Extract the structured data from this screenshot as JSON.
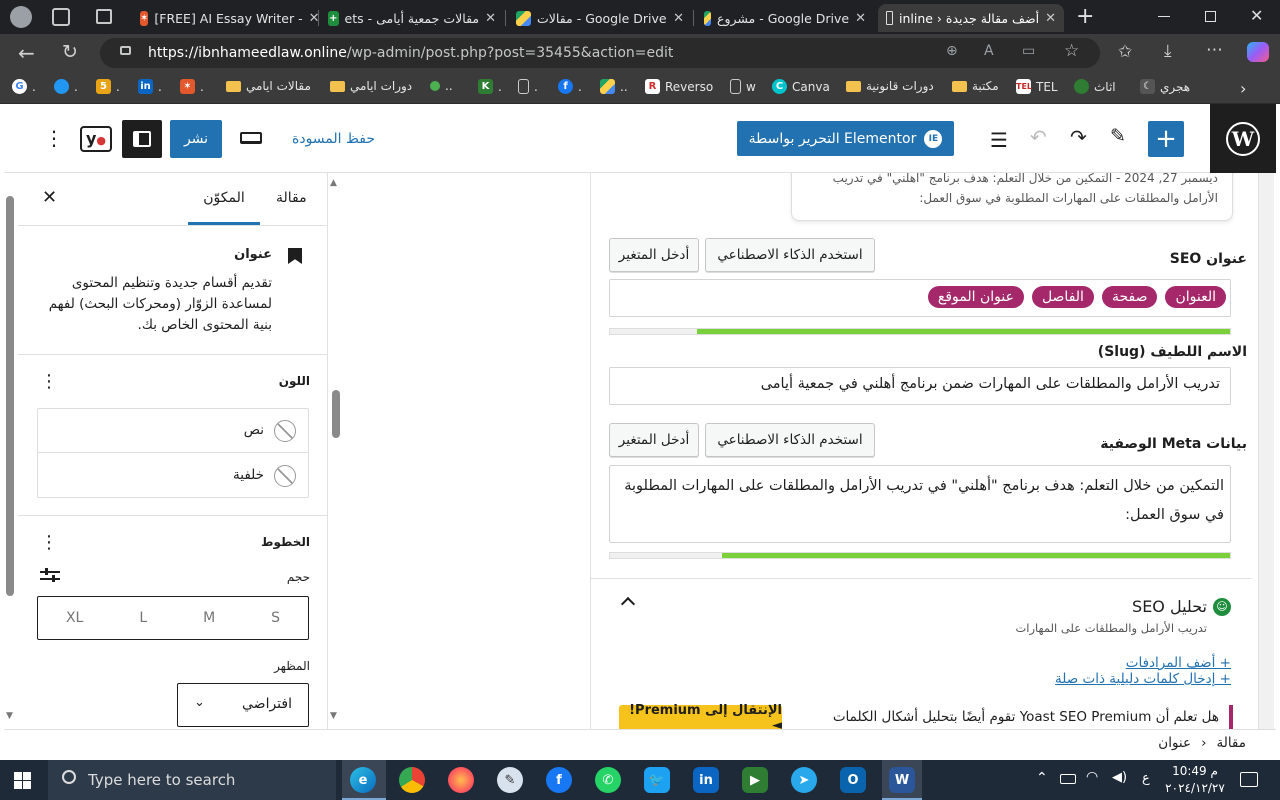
{
  "browser": {
    "tabs": [
      {
        "title": "[FREE] AI Essay Writer -"
      },
      {
        "title": "مقالات جمعية أيامى - ets"
      },
      {
        "title": "مقالات - Google Drive"
      },
      {
        "title": "مشروع - Google Drive"
      },
      {
        "title": "أضف مقالة جديدة ‹ inline"
      }
    ],
    "url_host": "https://ibnhameedlaw.online",
    "url_path": "/wp-admin/post.php?post=35455&action=edit",
    "bookmarks": [
      "مقالات ايامي",
      "دورات ايامي",
      "Reverso",
      "w",
      "Canva",
      "دورات قانونية",
      "مكتبة",
      "TEL",
      "اثاث",
      "هجري"
    ]
  },
  "wp_header": {
    "publish": "نشر",
    "save_draft": "حفظ المسودة",
    "elementor": "التحرير بواسطة Elementor"
  },
  "sidebar": {
    "tab_post": "مقالة",
    "tab_block": "المكوّن",
    "block_title": "عنوان",
    "block_desc": "تقديم أقسام جديدة وتنظيم المحتوى لمساعدة الزوّار (ومحركات البحث) لفهم بنية المحتوى الخاص بك.",
    "color_title": "اللون",
    "color_text": "نص",
    "color_bg": "خلفية",
    "typo_title": "الخطوط",
    "size_label": "حجم",
    "sizes": [
      "S",
      "M",
      "L",
      "XL"
    ],
    "appearance_label": "المظهر",
    "appearance_value": "افتراضي"
  },
  "seo": {
    "snippet_line1": "ديسمبر 27, 2024 - التمكين من خلال التعلم: هدف برنامج \"أهلني\" في تدريب",
    "snippet_line2": "الأرامل والمطلقات على المهارات المطلوبة في سوق العمل:",
    "seo_title_label": "عنوان SEO",
    "use_ai": "استخدم الذكاء الاصطناعي",
    "insert_var": "أدخل المتغير",
    "pills": [
      "العنوان",
      "صفحة",
      "الفاصل",
      "عنوان الموقع"
    ],
    "title_progress": 0.86,
    "slug_label": "الاسم اللطيف (Slug)",
    "slug_value": "تدريب الأرامل والمطلقات على المهارات ضمن برنامج أهلني في جمعية أيامى",
    "meta_label": "بيانات Meta الوصفية",
    "meta_value": "التمكين من خلال التعلم: هدف برنامج \"أهلني\" في تدريب الأرامل والمطلقات على المهارات المطلوبة في سوق العمل:",
    "meta_progress": 0.82,
    "analysis_title": "تحليل SEO",
    "analysis_sub": "تدريب الأرامل والمطلقات على المهارات",
    "add_synonyms": "+ أضف المرادفات",
    "add_keyphrases": "+ إدخال كلمات دليلية ذات صلة",
    "premium_text": "هل تعلم أن Yoast SEO Premium تقوم أيضًا بتحليل أشكال الكلمات",
    "premium_btn": "الإنتقال إلى Premium! ◄"
  },
  "breadcrumb": {
    "root": "مقالة",
    "current": "عنوان"
  },
  "taskbar": {
    "search_placeholder": "Type here to search",
    "time": "10:49 م",
    "date": "٢٠٢٤/١٢/٢٧",
    "lang": "ع"
  },
  "colors": {
    "wp_blue": "#2271b1",
    "yoast_purple": "#a4286a",
    "progress_green": "#7ad03a",
    "premium_yellow": "#f6c21c"
  }
}
